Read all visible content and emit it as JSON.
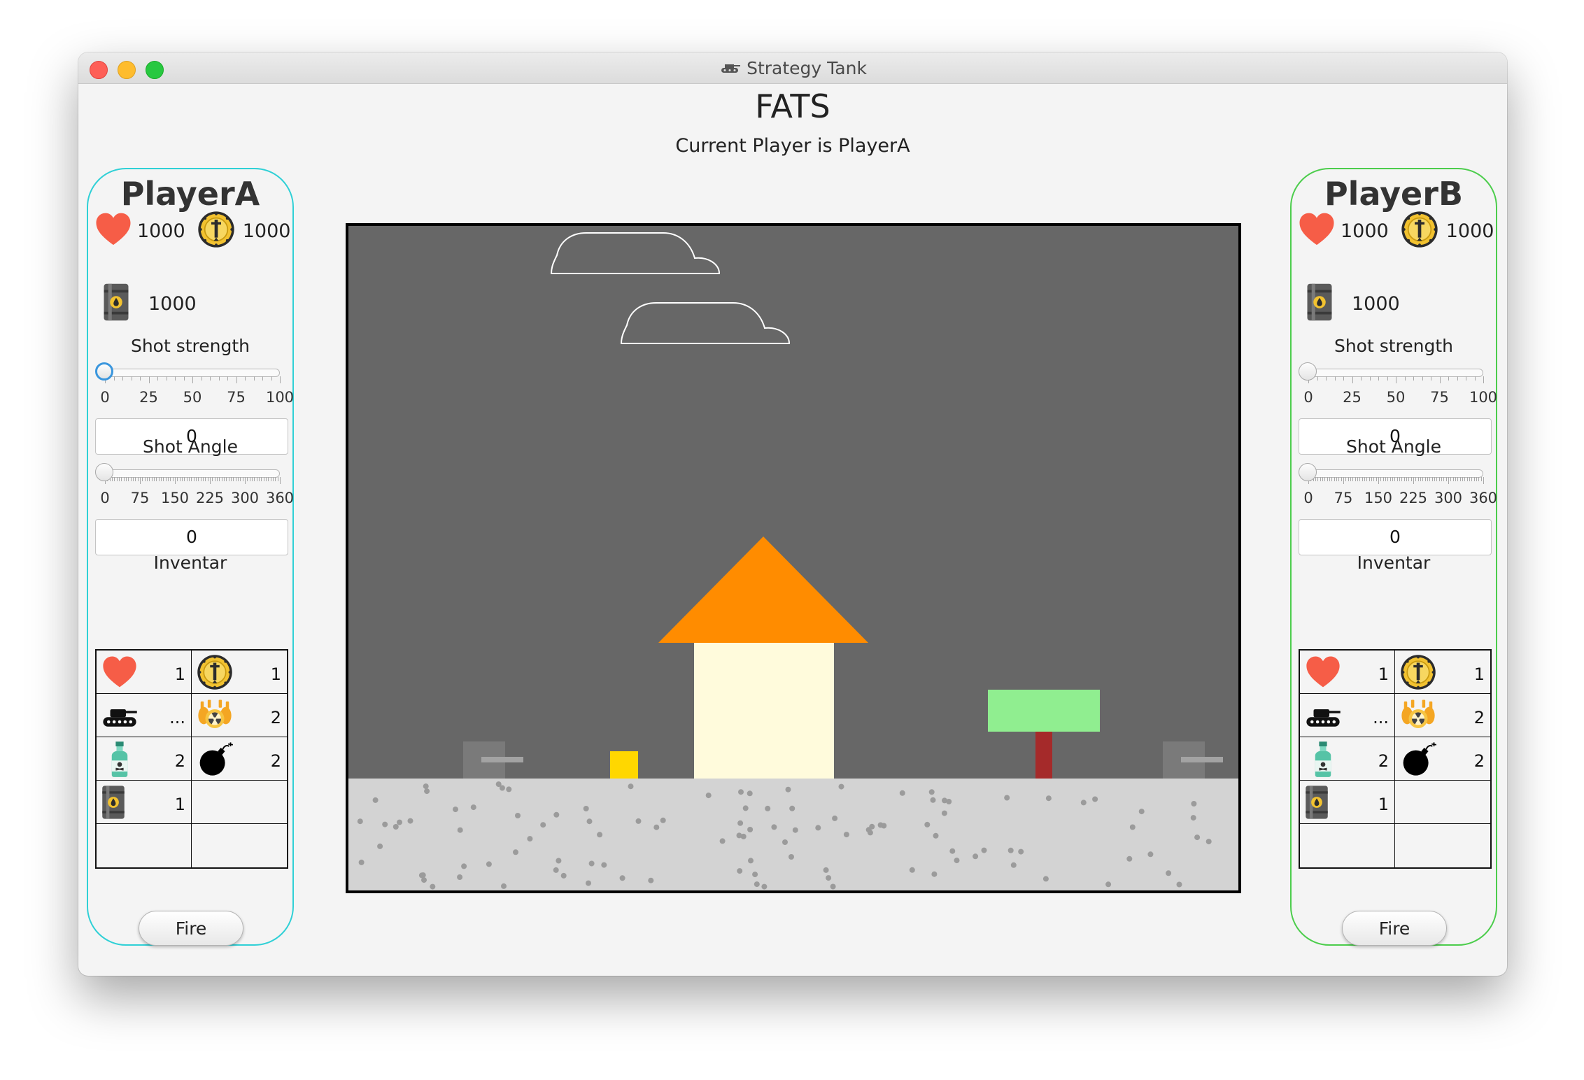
{
  "window": {
    "title": "Strategy Tank"
  },
  "header": {
    "game_title": "FATS",
    "current_player": "Current Player is PlayerA"
  },
  "players": [
    {
      "name": "PlayerA",
      "health": "1000",
      "coins": "1000",
      "fuel": "1000",
      "shot_strength_label": "Shot strength",
      "shot_strength_value": "0",
      "shot_strength_ticks": [
        "0",
        "25",
        "50",
        "75",
        "100"
      ],
      "shot_angle_label": "Shot Angle",
      "shot_angle_value": "0",
      "shot_angle_ticks": [
        "0",
        "75",
        "150",
        "225",
        "300",
        "360"
      ],
      "inventory_label": "Inventar",
      "inventory": [
        {
          "icon": "heart-icon",
          "count": "1"
        },
        {
          "icon": "coin-icon",
          "count": "1"
        },
        {
          "icon": "tank-icon",
          "count": "..."
        },
        {
          "icon": "nuclear-bomb-icon",
          "count": "2"
        },
        {
          "icon": "poison-bottle-icon",
          "count": "2"
        },
        {
          "icon": "bomb-icon",
          "count": "2"
        },
        {
          "icon": "fuel-barrel-icon",
          "count": "1"
        },
        {
          "icon": "",
          "count": ""
        },
        {
          "icon": "",
          "count": ""
        },
        {
          "icon": "",
          "count": ""
        }
      ],
      "fire_label": "Fire",
      "accent": "#2fd0d6"
    },
    {
      "name": "PlayerB",
      "health": "1000",
      "coins": "1000",
      "fuel": "1000",
      "shot_strength_label": "Shot strength",
      "shot_strength_value": "0",
      "shot_strength_ticks": [
        "0",
        "25",
        "50",
        "75",
        "100"
      ],
      "shot_angle_label": "Shot Angle",
      "shot_angle_value": "0",
      "shot_angle_ticks": [
        "0",
        "75",
        "150",
        "225",
        "300",
        "360"
      ],
      "inventory_label": "Inventar",
      "inventory": [
        {
          "icon": "heart-icon",
          "count": "1"
        },
        {
          "icon": "coin-icon",
          "count": "1"
        },
        {
          "icon": "tank-icon",
          "count": "..."
        },
        {
          "icon": "nuclear-bomb-icon",
          "count": "2"
        },
        {
          "icon": "poison-bottle-icon",
          "count": "2"
        },
        {
          "icon": "bomb-icon",
          "count": "2"
        },
        {
          "icon": "fuel-barrel-icon",
          "count": "1"
        },
        {
          "icon": "",
          "count": ""
        },
        {
          "icon": "",
          "count": ""
        },
        {
          "icon": "",
          "count": ""
        }
      ],
      "fire_label": "Fire",
      "accent": "#4ccd4c"
    }
  ],
  "scene": {
    "sky_color": "#676767",
    "ground_color": "#d3d3d3",
    "house_roof_color": "#ff8c00",
    "house_wall_color": "#fffbdc",
    "tree_top_color": "#90ee90",
    "tree_trunk_color": "#a52a2a",
    "crate_color": "#ffd700",
    "tank_color": "#7a7a7a",
    "cloud_color": "#ffffff"
  }
}
